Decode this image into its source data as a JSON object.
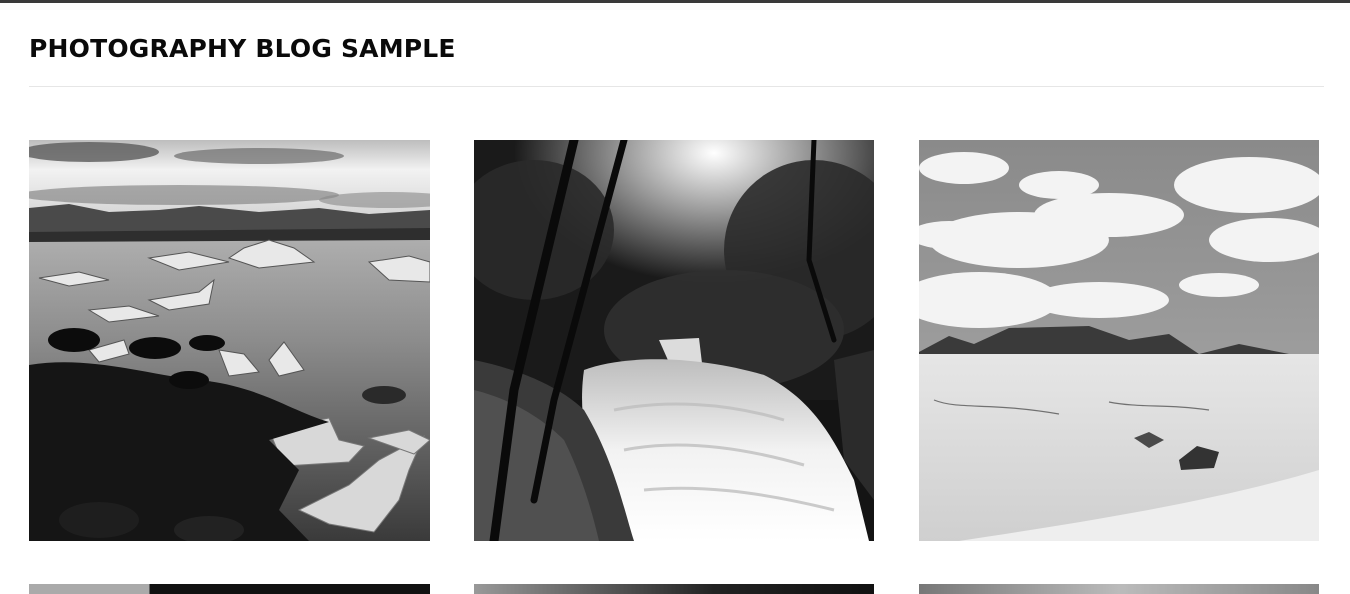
{
  "site": {
    "title": "PHOTOGRAPHY BLOG SAMPLE"
  },
  "gallery": {
    "row1": [
      {
        "subject": "icebergs-on-lake",
        "tone": "grayscale"
      },
      {
        "subject": "forest-waterfall",
        "tone": "grayscale"
      },
      {
        "subject": "desert-dunes-with-clouds",
        "tone": "grayscale"
      }
    ],
    "row2_visible": 3
  }
}
